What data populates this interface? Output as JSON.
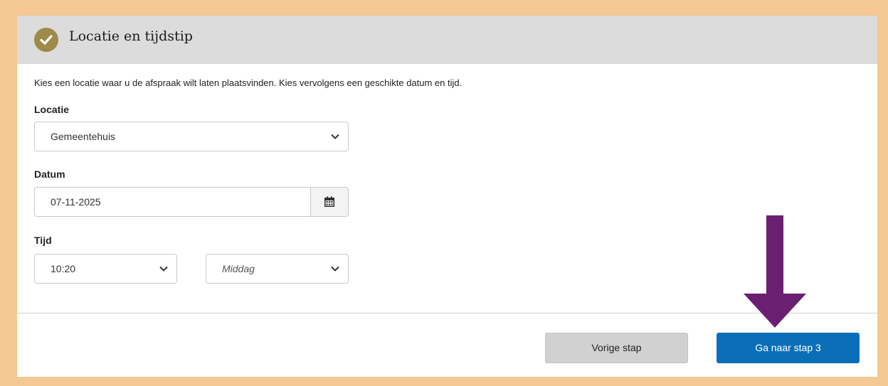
{
  "header": {
    "title": "Locatie en tijdstip"
  },
  "intro": "Kies een locatie waar u de afspraak wilt laten plaatsvinden. Kies vervolgens een geschikte datum en tijd.",
  "locatie": {
    "label": "Locatie",
    "value": "Gemeentehuis"
  },
  "datum": {
    "label": "Datum",
    "value": "07-11-2025"
  },
  "tijd": {
    "label": "Tijd",
    "time_value": "10:20",
    "daypart_value": "Middag"
  },
  "buttons": {
    "prev": "Vorige stap",
    "next": "Ga naar stap 3"
  },
  "colors": {
    "frame": "#f4c892",
    "header_bg": "#dcdcdc",
    "check_badge": "#9e8a49",
    "primary_button": "#0b6fb8",
    "secondary_button": "#d1d1d1",
    "annotation_arrow": "#6a1f71"
  },
  "icons": [
    "checkmark-icon",
    "chevron-down-icon",
    "calendar-icon",
    "arrow-down-annotation"
  ]
}
